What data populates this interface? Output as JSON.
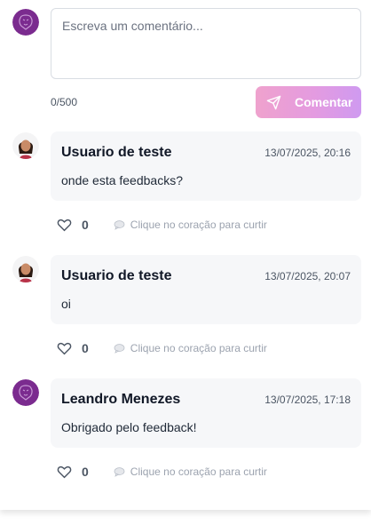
{
  "composer": {
    "placeholder": "Escreva um comentário...",
    "char_count": "0/500",
    "submit_label": "Comentar",
    "avatar_icon": "lion-crest-icon"
  },
  "like_hint": "Clique no coração para curtir",
  "comments": [
    {
      "author": "Usuario de teste",
      "date": "13/07/2025, 20:16",
      "text": "onde esta feedbacks?",
      "likes": "0",
      "avatar_icon": "woman-avatar-icon"
    },
    {
      "author": "Usuario de teste",
      "date": "13/07/2025, 20:07",
      "text": "oi",
      "likes": "0",
      "avatar_icon": "woman-avatar-icon"
    },
    {
      "author": "Leandro Menezes",
      "date": "13/07/2025, 17:18",
      "text": "Obrigado pelo feedback!",
      "likes": "0",
      "avatar_icon": "lion-crest-icon"
    }
  ],
  "colors": {
    "brand_purple": "#7b2b8f",
    "button_gradient_start": "#efa2cd",
    "button_gradient_end": "#cf9af0",
    "card_bg": "#f6f7f9"
  }
}
